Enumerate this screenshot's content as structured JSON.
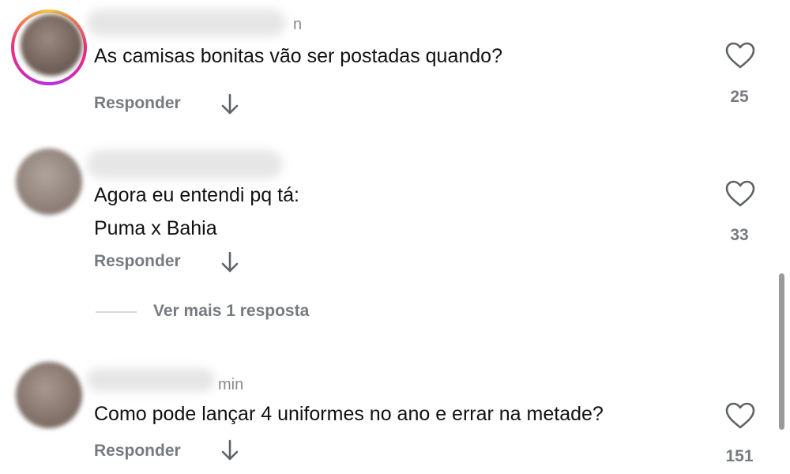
{
  "comments": [
    {
      "time": "n",
      "text": "As camisas bonitas vão ser postadas quando?",
      "reply_label": "Responder",
      "likes": "25",
      "has_story_ring": true,
      "avatar_color": "#7a6a62"
    },
    {
      "time": "",
      "text": "Agora eu entendi pq tá:\nPuma x Bahia",
      "reply_label": "Responder",
      "likes": "33",
      "has_story_ring": false,
      "avatar_color": "#8c7f77"
    },
    {
      "time": "min",
      "text": "Como pode lançar 4 uniformes no ano e errar na metade?",
      "reply_label": "Responder",
      "likes": "151",
      "has_story_ring": false,
      "avatar_color": "#85756d"
    }
  ],
  "view_more": {
    "label": "Ver mais 1 resposta"
  },
  "icons": {
    "like": "heart-outline-icon",
    "expand": "arrow-down-icon"
  },
  "colors": {
    "secondary_text": "#777b80",
    "primary_text": "#111111",
    "ring_gradient": [
      "#f9ce34",
      "#ee2a7b",
      "#b52fe0"
    ]
  }
}
